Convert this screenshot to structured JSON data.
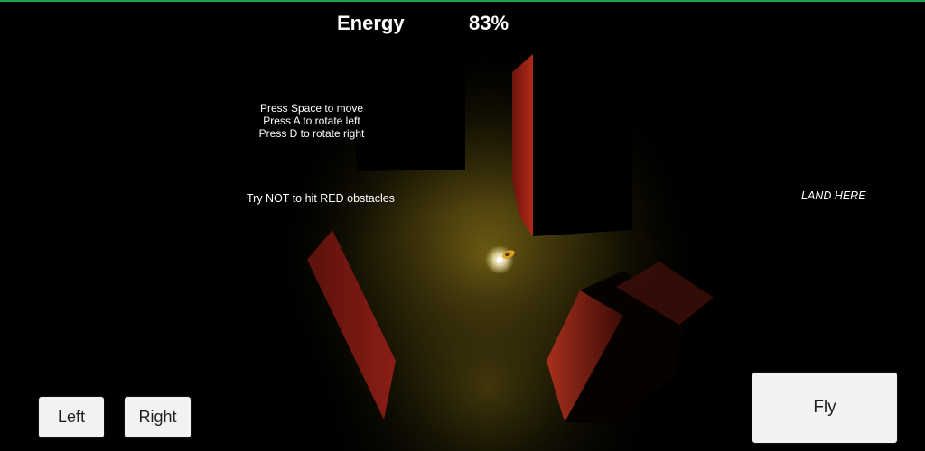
{
  "hud": {
    "energy_label": "Energy",
    "energy_value": "83%"
  },
  "instructions": {
    "line1": "Press Space to move",
    "line2": "Press A to rotate left",
    "line3": "Press D to rotate right"
  },
  "warning_text": "Try NOT to hit RED obstacles",
  "goal_text": "LAND HERE",
  "controls": {
    "left_label": "Left",
    "right_label": "Right",
    "fly_label": "Fly"
  },
  "colors": {
    "background": "#000000",
    "light": "#c9a31e",
    "obstacle_red": "#a3231a",
    "top_bar": "#1aa34a"
  }
}
